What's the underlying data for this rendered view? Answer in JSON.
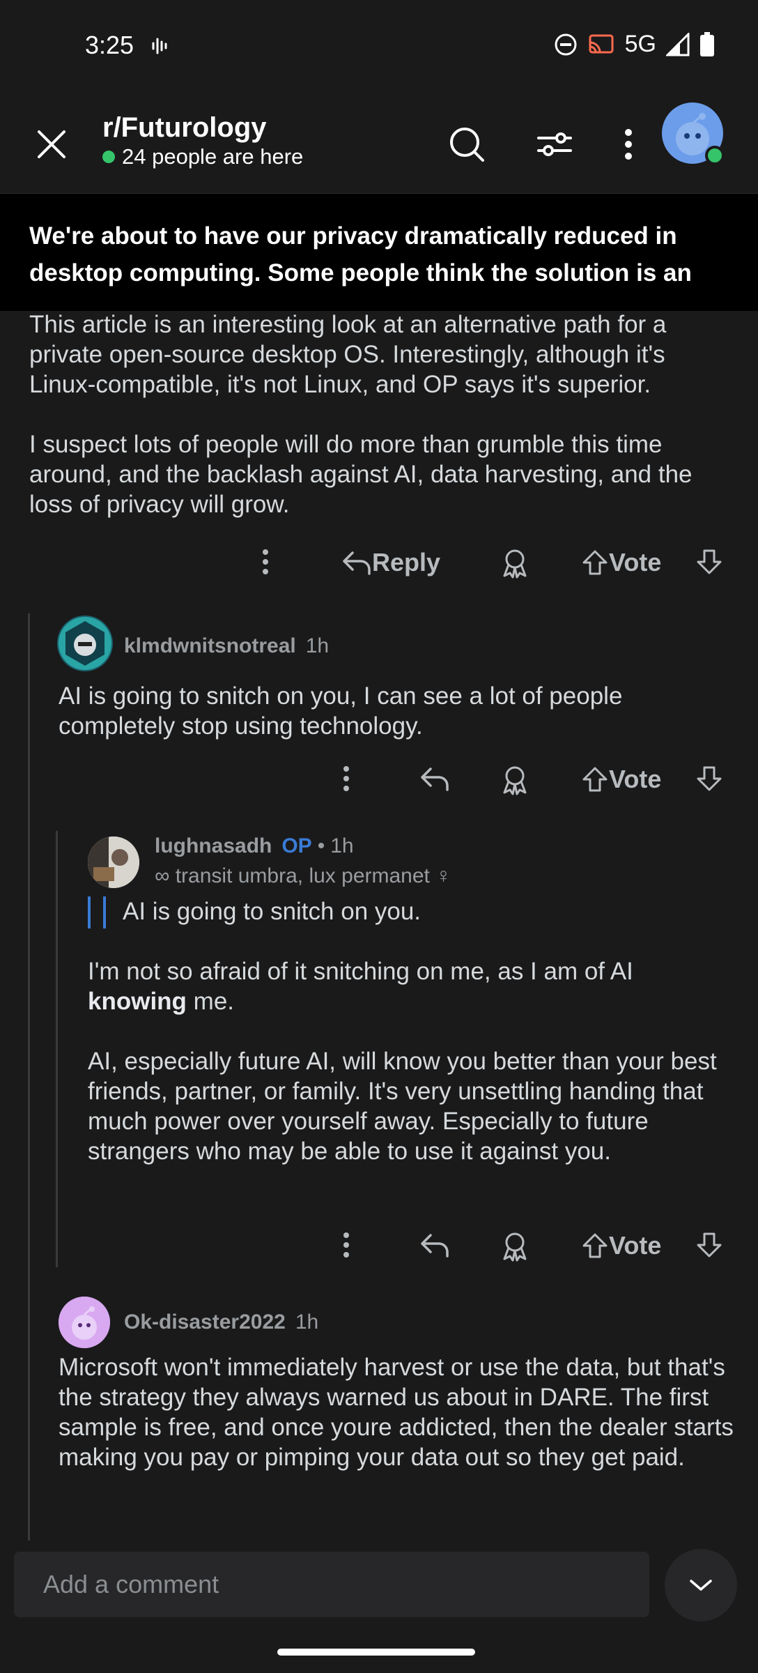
{
  "status_bar": {
    "time": "3:25",
    "network": "5G"
  },
  "header": {
    "subreddit": "r/Futurology",
    "online_text": "24 people are here",
    "icons": [
      "close-icon",
      "search-icon",
      "filter-icon",
      "more-icon",
      "avatar"
    ]
  },
  "post": {
    "title": "We're about to have our privacy dramatically reduced in desktop computing. Some people think the solution is an op…",
    "body_paragraphs": [
      "This article is an interesting look at an alternative path for a private open-source desktop OS. Interestingly, although it's Linux-compatible, it's not Linux, and OP says it's superior.",
      "I suspect lots of people will do more than grumble this time around, and the backlash against AI, data harvesting, and the loss of privacy will grow."
    ],
    "reply_label": "Reply",
    "vote_label": "Vote"
  },
  "comments": [
    {
      "username": "klmdwnitsnotreal",
      "time": "1h",
      "text": "AI is going to snitch on you, I can see a lot of people completely stop using technology.",
      "vote_label": "Vote"
    },
    {
      "username": "lughnasadh",
      "op_badge": "OP",
      "separator": "•",
      "time": "1h",
      "flair": "∞ transit umbra, lux permanet ♀",
      "quote": "AI is going to snitch on you.",
      "para1_before": "I'm not so afraid of it snitching on me, as I am of AI",
      "para1_bold": "knowing",
      "para1_after": "me.",
      "para2": "AI, especially future AI, will know you better than your best friends, partner, or family. It's very unsettling handing that much power over yourself away. Especially to future strangers who may be able to use it against you.",
      "vote_label": "Vote"
    },
    {
      "username": "Ok-disaster2022",
      "time": "1h",
      "text": "Microsoft won't immediately harvest or use the data, but that's the strategy they always warned us about in DARE. The first sample is free, and once youre addicted, then the dealer starts making you pay or pimping your data out so they get paid."
    }
  ],
  "composer": {
    "placeholder": "Add a comment"
  },
  "colors": {
    "accent_blue": "#3a7bd5",
    "online_green": "#36c46b",
    "background": "#1a1a1b"
  }
}
